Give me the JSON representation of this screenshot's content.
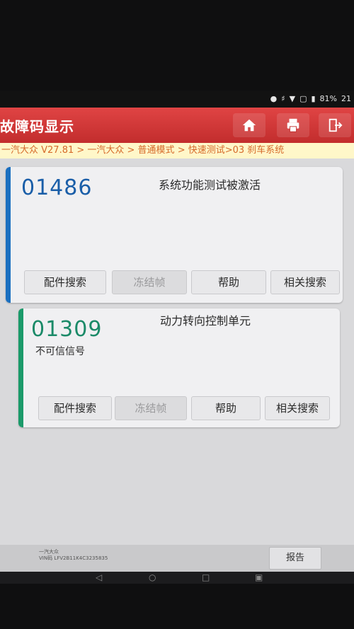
{
  "status": {
    "battery": "81%",
    "time": "21",
    "icons": [
      "location-icon",
      "bluetooth-icon",
      "wifi-icon",
      "signal-icon",
      "battery-icon"
    ]
  },
  "header": {
    "title": "故障码显示",
    "buttons": [
      "home-icon",
      "print-icon",
      "exit-icon"
    ]
  },
  "breadcrumb": "一汽大众 V27.81 > 一汽大众 > 普通模式 > 快速测试>03 刹车系统",
  "cards": [
    {
      "code": "01486",
      "title": "系统功能测试被激活",
      "description": "",
      "stripe_color": "#1a6fc0",
      "buttons": [
        "配件搜索",
        "冻结帧",
        "帮助",
        "相关搜索"
      ]
    },
    {
      "code": "01309",
      "title": "动力转向控制单元",
      "description": "不可信信号",
      "stripe_color": "#1b9a6a",
      "buttons": [
        "配件搜索",
        "冻结帧",
        "帮助",
        "相关搜索"
      ]
    }
  ],
  "footer": {
    "vehicle_line1": "一汽大众",
    "vehicle_line2": "VIN码 LFV2B11K4C3235835",
    "report_label": "报告"
  },
  "nav": [
    "back-icon",
    "home-circle-icon",
    "recent-apps-icon",
    "screenshot-icon"
  ]
}
